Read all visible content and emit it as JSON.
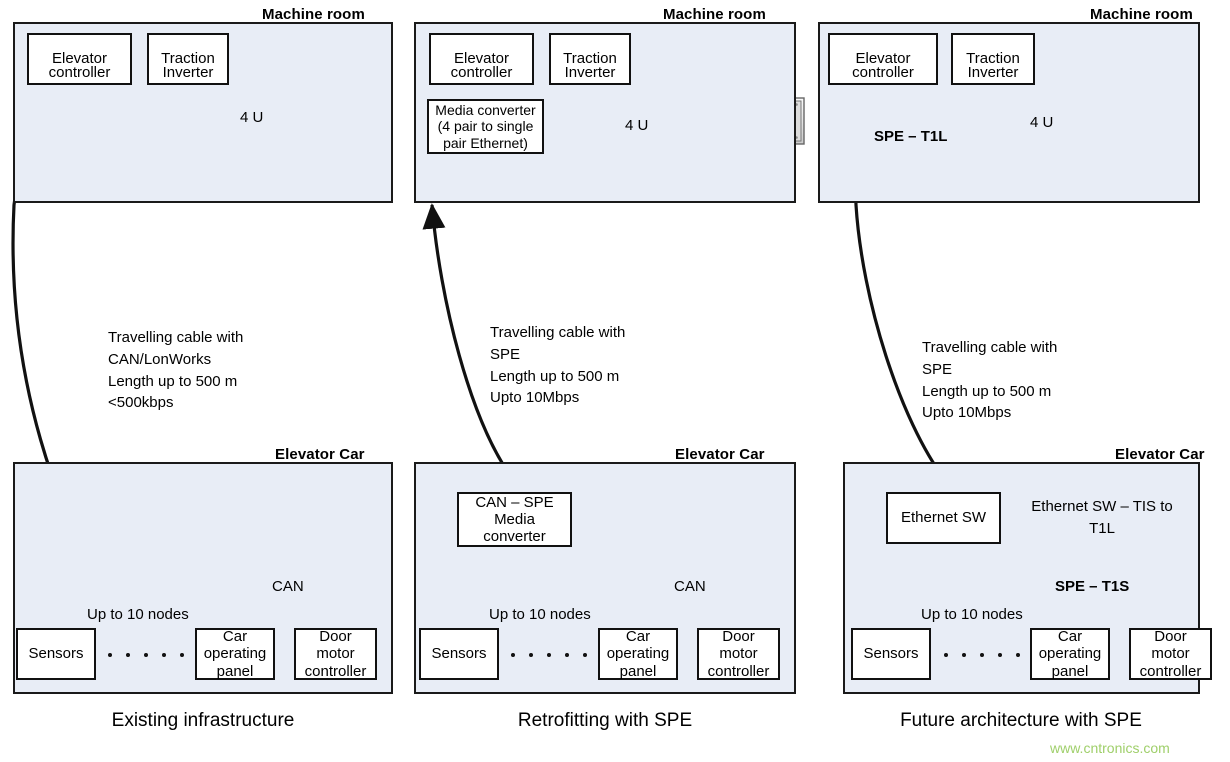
{
  "figure": {
    "watermark": "www.cntronics.com"
  },
  "columns": [
    {
      "id": "existing",
      "caption": "Existing infrastructure",
      "machine_room": {
        "title": "Machine room",
        "boxes": [
          {
            "name": "elevator-controller",
            "lines": [
              "Elevator",
              "controller"
            ]
          },
          {
            "name": "traction-inverter",
            "lines": [
              "Traction",
              "Inverter"
            ]
          }
        ],
        "rack_label": "4 U",
        "bus_label": "",
        "icons": [
          "battery-bank-icon",
          "server-rack-icon",
          "motor-sheave-icon"
        ]
      },
      "cable_note": "Travelling cable with\nCAN/LonWorks\nLength up to 500 m\n<500kbps",
      "elevator_car": {
        "title": "Elevator Car",
        "converter": null,
        "converter_note": null,
        "bus_name": "CAN",
        "bus_name_bold": false,
        "nodes_label": "Up to 10 nodes",
        "devices": [
          {
            "name": "sensors",
            "lines": [
              "Sensors"
            ]
          },
          {
            "name": "car-operating-panel",
            "lines": [
              "Car",
              "operating",
              "panel"
            ]
          },
          {
            "name": "door-motor-controller",
            "lines": [
              "Door",
              "motor",
              "controller"
            ]
          }
        ]
      }
    },
    {
      "id": "retrofit",
      "caption": "Retrofitting with SPE",
      "machine_room": {
        "title": "Machine room",
        "boxes": [
          {
            "name": "elevator-controller",
            "lines": [
              "Elevator",
              "controller"
            ]
          },
          {
            "name": "traction-inverter",
            "lines": [
              "Traction",
              "Inverter"
            ]
          },
          {
            "name": "media-converter",
            "lines": [
              "Media converter",
              "(4 pair to single",
              "pair Ethernet)"
            ]
          }
        ],
        "rack_label": "4 U",
        "bus_label": "",
        "icons": [
          "battery-bank-icon",
          "server-rack-icon",
          "motor-sheave-icon"
        ]
      },
      "cable_note": "Travelling cable with\nSPE\nLength up to 500 m\nUpto 10Mbps",
      "elevator_car": {
        "title": "Elevator Car",
        "converter": {
          "name": "can-spe-media-converter",
          "lines": [
            "CAN – SPE",
            "Media converter"
          ]
        },
        "converter_note": null,
        "bus_name": "CAN",
        "bus_name_bold": false,
        "nodes_label": "Up to 10 nodes",
        "devices": [
          {
            "name": "sensors",
            "lines": [
              "Sensors"
            ]
          },
          {
            "name": "car-operating-panel",
            "lines": [
              "Car",
              "operating",
              "panel"
            ]
          },
          {
            "name": "door-motor-controller",
            "lines": [
              "Door",
              "motor",
              "controller"
            ]
          }
        ]
      }
    },
    {
      "id": "future",
      "caption": "Future architecture with SPE",
      "machine_room": {
        "title": "Machine room",
        "boxes": [
          {
            "name": "elevator-controller",
            "lines": [
              "Elevator",
              "controller"
            ]
          },
          {
            "name": "traction-inverter",
            "lines": [
              "Traction",
              "Inverter"
            ]
          }
        ],
        "rack_label": "4 U",
        "bus_label": "SPE – T1L",
        "icons": [
          "battery-bank-icon",
          "server-rack-icon",
          "motor-sheave-icon"
        ]
      },
      "cable_note": "Travelling cable with\nSPE\nLength up to 500 m\nUpto 10Mbps",
      "elevator_car": {
        "title": "Elevator Car",
        "converter": {
          "name": "ethernet-switch",
          "lines": [
            "Ethernet SW"
          ]
        },
        "converter_note": "Ethernet SW – TIS to\nT1L",
        "bus_name": "SPE – T1S",
        "bus_name_bold": true,
        "nodes_label": "Up to 10 nodes",
        "devices": [
          {
            "name": "sensors",
            "lines": [
              "Sensors"
            ]
          },
          {
            "name": "car-operating-panel",
            "lines": [
              "Car",
              "operating",
              "panel"
            ]
          },
          {
            "name": "door-motor-controller",
            "lines": [
              "Door",
              "motor",
              "controller"
            ]
          }
        ]
      }
    }
  ]
}
